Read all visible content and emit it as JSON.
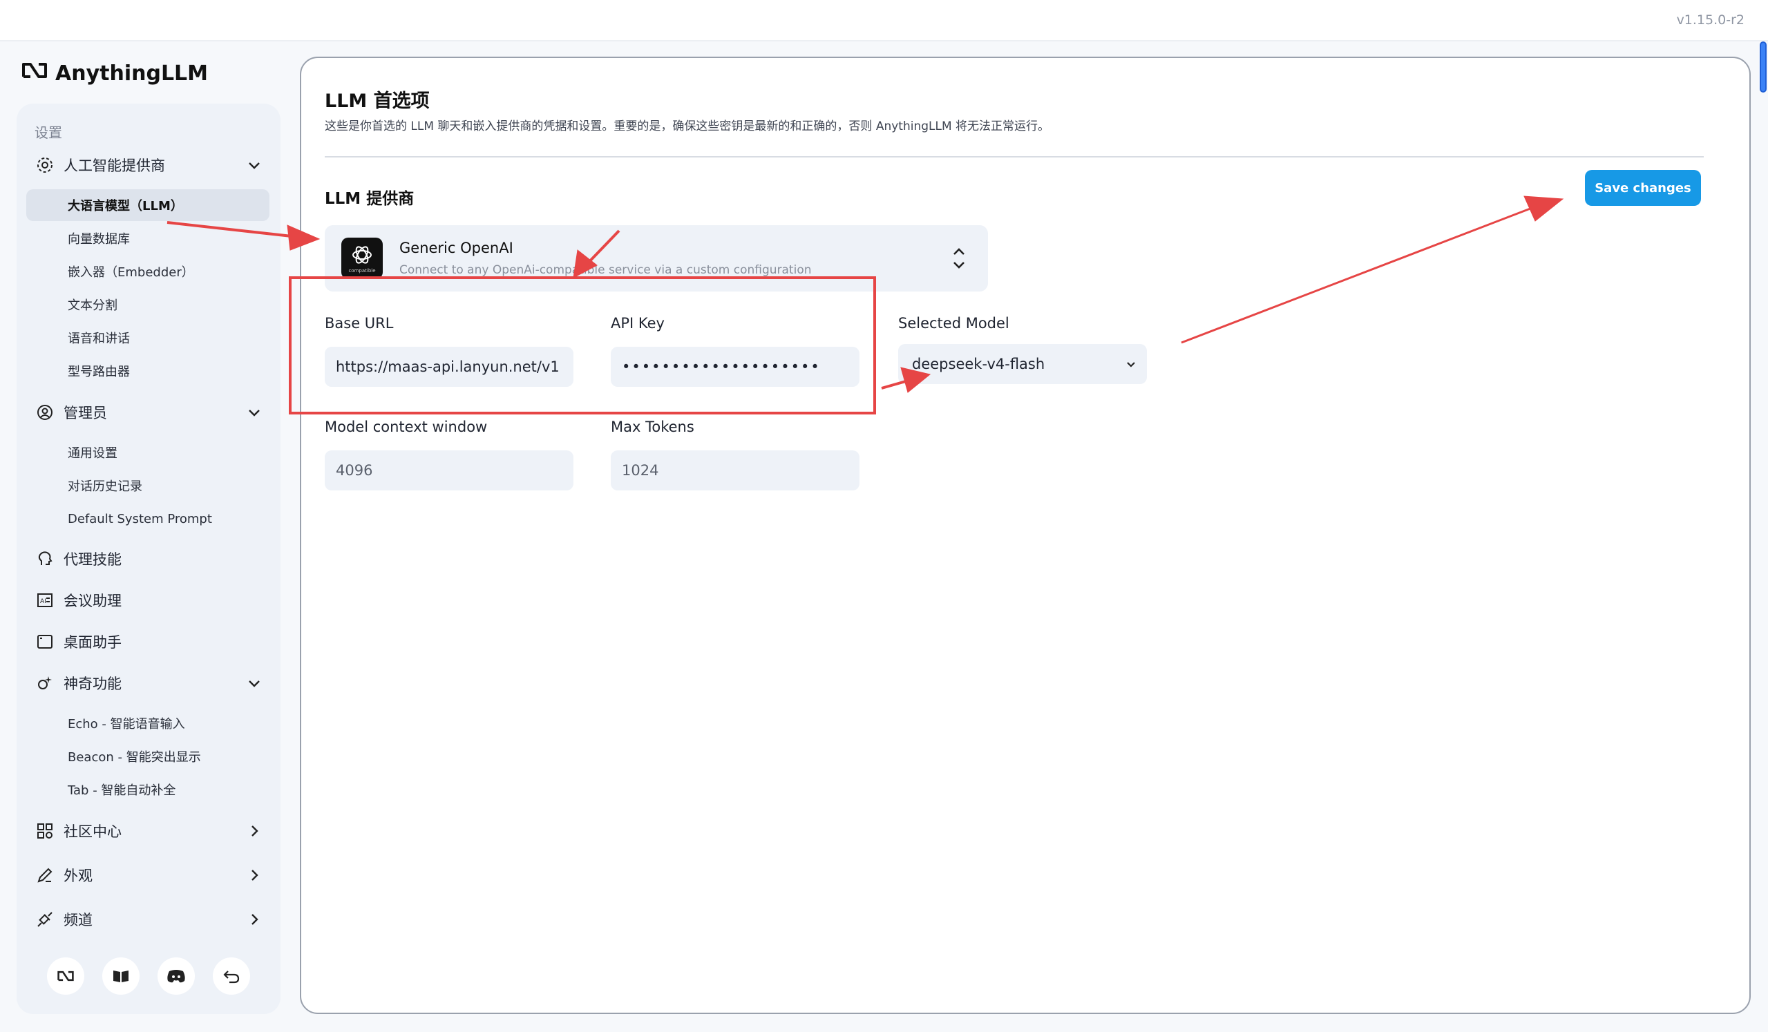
{
  "app": {
    "version": "v1.15.0-r2",
    "brand": "AnythingLLM"
  },
  "sidebar": {
    "section_title": "设置",
    "groups": [
      {
        "label": "人工智能提供商",
        "icon": "gear-icon",
        "items": [
          "大语言模型（LLM）",
          "向量数据库",
          "嵌入器（Embedder）",
          "文本分割",
          "语音和讲话",
          "型号路由器"
        ]
      },
      {
        "label": "管理员",
        "icon": "user-admin-icon",
        "items": [
          "通用设置",
          "对话历史记录",
          "Default System Prompt"
        ]
      },
      {
        "label": "代理技能",
        "icon": "agent-icon",
        "items": []
      },
      {
        "label": "会议助理",
        "icon": "meeting-icon",
        "items": []
      },
      {
        "label": "桌面助手",
        "icon": "desktop-icon",
        "items": []
      },
      {
        "label": "神奇功能",
        "icon": "magic-icon",
        "items": [
          "Echo - 智能语音输入",
          "Beacon - 智能突出显示",
          "Tab - 智能自动补全"
        ]
      },
      {
        "label": "社区中心",
        "icon": "community-icon",
        "items": []
      },
      {
        "label": "外观",
        "icon": "pen-icon",
        "items": []
      },
      {
        "label": "频道",
        "icon": "plug-icon",
        "items": []
      }
    ],
    "bottom_icons": [
      "anythingllm-logo-icon",
      "book-icon",
      "discord-icon",
      "undo-icon"
    ]
  },
  "main": {
    "title": "LLM 首选项",
    "description": "这些是你首选的 LLM 聊天和嵌入提供商的凭据和设置。重要的是，确保这些密钥是最新的和正确的，否则 AnythingLLM 将无法正常运行。",
    "save_label": "Save changes",
    "provider_section_title": "LLM 提供商",
    "provider": {
      "name": "Generic OpenAI",
      "description": "Connect to any OpenAi-compatible service via a custom configuration",
      "logo_caption": "compatible"
    },
    "fields": {
      "base_url": {
        "label": "Base URL",
        "value": "https://maas-api.lanyun.net/v1"
      },
      "api_key": {
        "label": "API Key",
        "value": "••••••••••••••••••••"
      },
      "selected_model": {
        "label": "Selected Model",
        "value": "deepseek-v4-flash"
      },
      "context_window": {
        "label": "Model context window",
        "value": "4096"
      },
      "max_tokens": {
        "label": "Max Tokens",
        "value": "1024"
      }
    }
  },
  "colors": {
    "accent": "#1799e6",
    "annotation": "#e64545",
    "sidebar_bg": "#eef2f8"
  }
}
